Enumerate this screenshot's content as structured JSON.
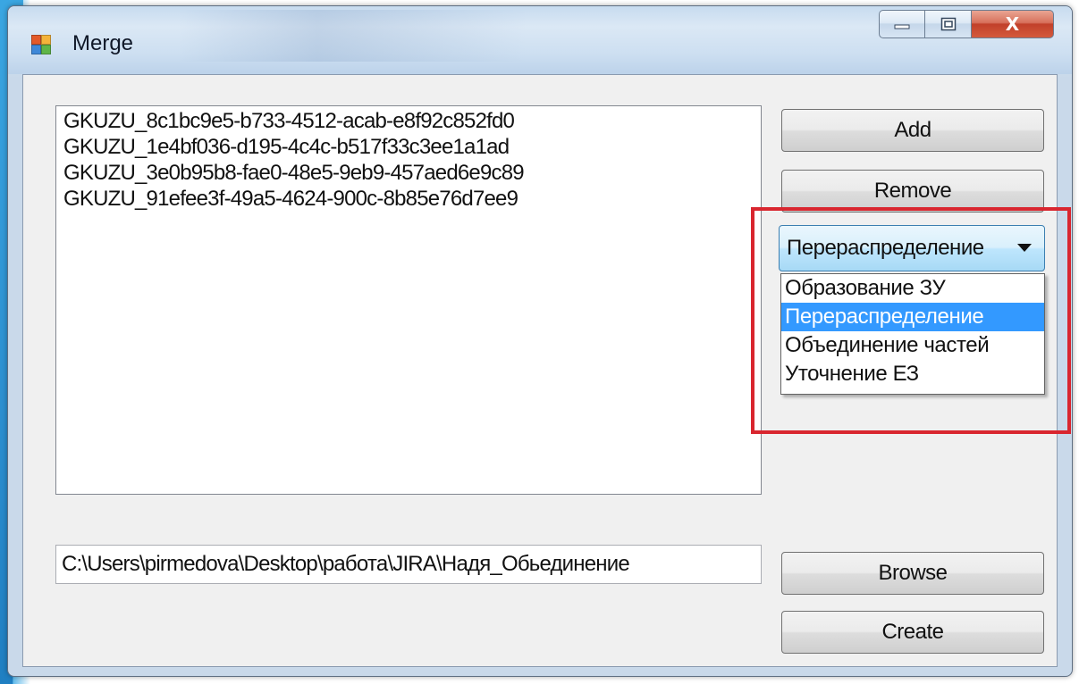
{
  "window": {
    "title": "Merge",
    "close_glyph": "X",
    "icons": {
      "app": "app-window-icon",
      "minimize": "minimize-icon",
      "maximize": "maximize-icon",
      "close": "close-icon"
    }
  },
  "list": {
    "items": [
      "GKUZU_8c1bc9e5-b733-4512-acab-e8f92c852fd0",
      "GKUZU_1e4bf036-d195-4c4c-b517f33c3ee1a1ad",
      "GKUZU_3e0b95b8-fae0-48e5-9eb9-457aed6e9c89",
      "GKUZU_91efee3f-49a5-4624-900c-8b85e76d7ee9"
    ]
  },
  "buttons": {
    "add": "Add",
    "remove": "Remove",
    "browse": "Browse",
    "create": "Create"
  },
  "combo": {
    "selected": "Перераспределение",
    "options": [
      "Образование ЗУ",
      "Перераспределение",
      "Объединение частей",
      "Уточнение ЕЗ"
    ],
    "selected_index": 1
  },
  "path": {
    "value": "C:\\Users\\pirmedova\\Desktop\\работа\\JIRA\\Надя_Обьединение"
  },
  "colors": {
    "selection": "#3399ff",
    "annotation_box": "#d9262f",
    "close_button": "#c1402a"
  }
}
